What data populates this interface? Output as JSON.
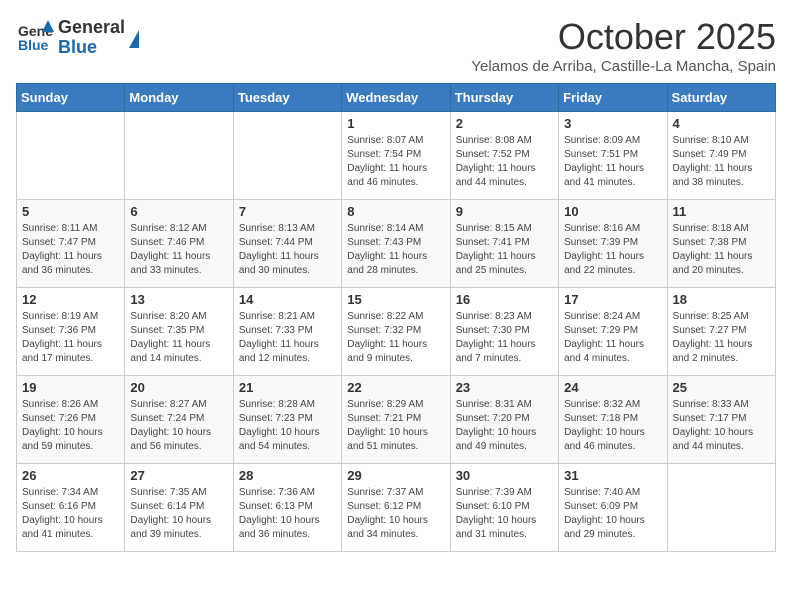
{
  "header": {
    "logo_general": "General",
    "logo_blue": "Blue",
    "month_title": "October 2025",
    "location": "Yelamos de Arriba, Castille-La Mancha, Spain"
  },
  "days_of_week": [
    "Sunday",
    "Monday",
    "Tuesday",
    "Wednesday",
    "Thursday",
    "Friday",
    "Saturday"
  ],
  "weeks": [
    [
      {
        "day": "",
        "content": ""
      },
      {
        "day": "",
        "content": ""
      },
      {
        "day": "",
        "content": ""
      },
      {
        "day": "1",
        "content": "Sunrise: 8:07 AM\nSunset: 7:54 PM\nDaylight: 11 hours and 46 minutes."
      },
      {
        "day": "2",
        "content": "Sunrise: 8:08 AM\nSunset: 7:52 PM\nDaylight: 11 hours and 44 minutes."
      },
      {
        "day": "3",
        "content": "Sunrise: 8:09 AM\nSunset: 7:51 PM\nDaylight: 11 hours and 41 minutes."
      },
      {
        "day": "4",
        "content": "Sunrise: 8:10 AM\nSunset: 7:49 PM\nDaylight: 11 hours and 38 minutes."
      }
    ],
    [
      {
        "day": "5",
        "content": "Sunrise: 8:11 AM\nSunset: 7:47 PM\nDaylight: 11 hours and 36 minutes."
      },
      {
        "day": "6",
        "content": "Sunrise: 8:12 AM\nSunset: 7:46 PM\nDaylight: 11 hours and 33 minutes."
      },
      {
        "day": "7",
        "content": "Sunrise: 8:13 AM\nSunset: 7:44 PM\nDaylight: 11 hours and 30 minutes."
      },
      {
        "day": "8",
        "content": "Sunrise: 8:14 AM\nSunset: 7:43 PM\nDaylight: 11 hours and 28 minutes."
      },
      {
        "day": "9",
        "content": "Sunrise: 8:15 AM\nSunset: 7:41 PM\nDaylight: 11 hours and 25 minutes."
      },
      {
        "day": "10",
        "content": "Sunrise: 8:16 AM\nSunset: 7:39 PM\nDaylight: 11 hours and 22 minutes."
      },
      {
        "day": "11",
        "content": "Sunrise: 8:18 AM\nSunset: 7:38 PM\nDaylight: 11 hours and 20 minutes."
      }
    ],
    [
      {
        "day": "12",
        "content": "Sunrise: 8:19 AM\nSunset: 7:36 PM\nDaylight: 11 hours and 17 minutes."
      },
      {
        "day": "13",
        "content": "Sunrise: 8:20 AM\nSunset: 7:35 PM\nDaylight: 11 hours and 14 minutes."
      },
      {
        "day": "14",
        "content": "Sunrise: 8:21 AM\nSunset: 7:33 PM\nDaylight: 11 hours and 12 minutes."
      },
      {
        "day": "15",
        "content": "Sunrise: 8:22 AM\nSunset: 7:32 PM\nDaylight: 11 hours and 9 minutes."
      },
      {
        "day": "16",
        "content": "Sunrise: 8:23 AM\nSunset: 7:30 PM\nDaylight: 11 hours and 7 minutes."
      },
      {
        "day": "17",
        "content": "Sunrise: 8:24 AM\nSunset: 7:29 PM\nDaylight: 11 hours and 4 minutes."
      },
      {
        "day": "18",
        "content": "Sunrise: 8:25 AM\nSunset: 7:27 PM\nDaylight: 11 hours and 2 minutes."
      }
    ],
    [
      {
        "day": "19",
        "content": "Sunrise: 8:26 AM\nSunset: 7:26 PM\nDaylight: 10 hours and 59 minutes."
      },
      {
        "day": "20",
        "content": "Sunrise: 8:27 AM\nSunset: 7:24 PM\nDaylight: 10 hours and 56 minutes."
      },
      {
        "day": "21",
        "content": "Sunrise: 8:28 AM\nSunset: 7:23 PM\nDaylight: 10 hours and 54 minutes."
      },
      {
        "day": "22",
        "content": "Sunrise: 8:29 AM\nSunset: 7:21 PM\nDaylight: 10 hours and 51 minutes."
      },
      {
        "day": "23",
        "content": "Sunrise: 8:31 AM\nSunset: 7:20 PM\nDaylight: 10 hours and 49 minutes."
      },
      {
        "day": "24",
        "content": "Sunrise: 8:32 AM\nSunset: 7:18 PM\nDaylight: 10 hours and 46 minutes."
      },
      {
        "day": "25",
        "content": "Sunrise: 8:33 AM\nSunset: 7:17 PM\nDaylight: 10 hours and 44 minutes."
      }
    ],
    [
      {
        "day": "26",
        "content": "Sunrise: 7:34 AM\nSunset: 6:16 PM\nDaylight: 10 hours and 41 minutes."
      },
      {
        "day": "27",
        "content": "Sunrise: 7:35 AM\nSunset: 6:14 PM\nDaylight: 10 hours and 39 minutes."
      },
      {
        "day": "28",
        "content": "Sunrise: 7:36 AM\nSunset: 6:13 PM\nDaylight: 10 hours and 36 minutes."
      },
      {
        "day": "29",
        "content": "Sunrise: 7:37 AM\nSunset: 6:12 PM\nDaylight: 10 hours and 34 minutes."
      },
      {
        "day": "30",
        "content": "Sunrise: 7:39 AM\nSunset: 6:10 PM\nDaylight: 10 hours and 31 minutes."
      },
      {
        "day": "31",
        "content": "Sunrise: 7:40 AM\nSunset: 6:09 PM\nDaylight: 10 hours and 29 minutes."
      },
      {
        "day": "",
        "content": ""
      }
    ]
  ]
}
